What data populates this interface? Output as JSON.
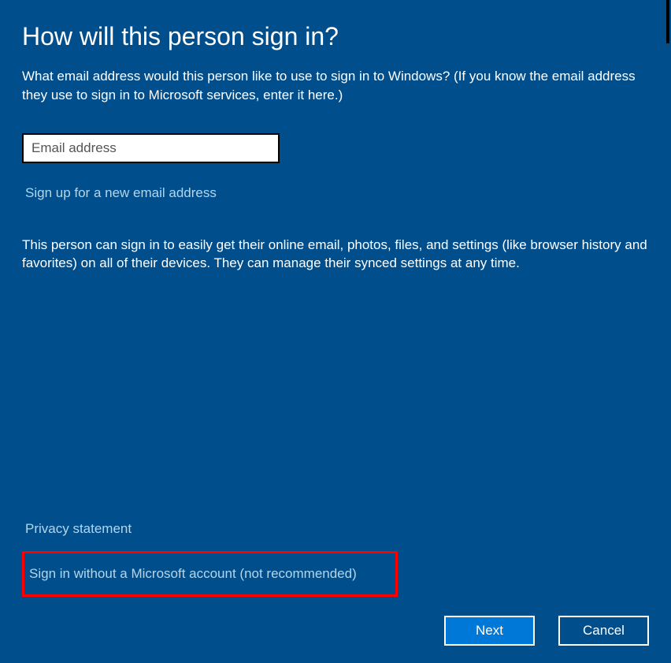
{
  "title": "How will this person sign in?",
  "subtitle": "What email address would this person like to use to sign in to Windows? (If you know the email address they use to sign in to Microsoft services, enter it here.)",
  "email_input": {
    "placeholder": "Email address",
    "value": ""
  },
  "signup_link": "Sign up for a new email address",
  "description": "This person can sign in to easily get their online email, photos, files, and settings (like browser history and favorites) on all of their devices. They can manage their synced settings at any time.",
  "privacy_link": "Privacy statement",
  "no_account_link": "Sign in without a Microsoft account (not recommended)",
  "buttons": {
    "next": "Next",
    "cancel": "Cancel"
  }
}
